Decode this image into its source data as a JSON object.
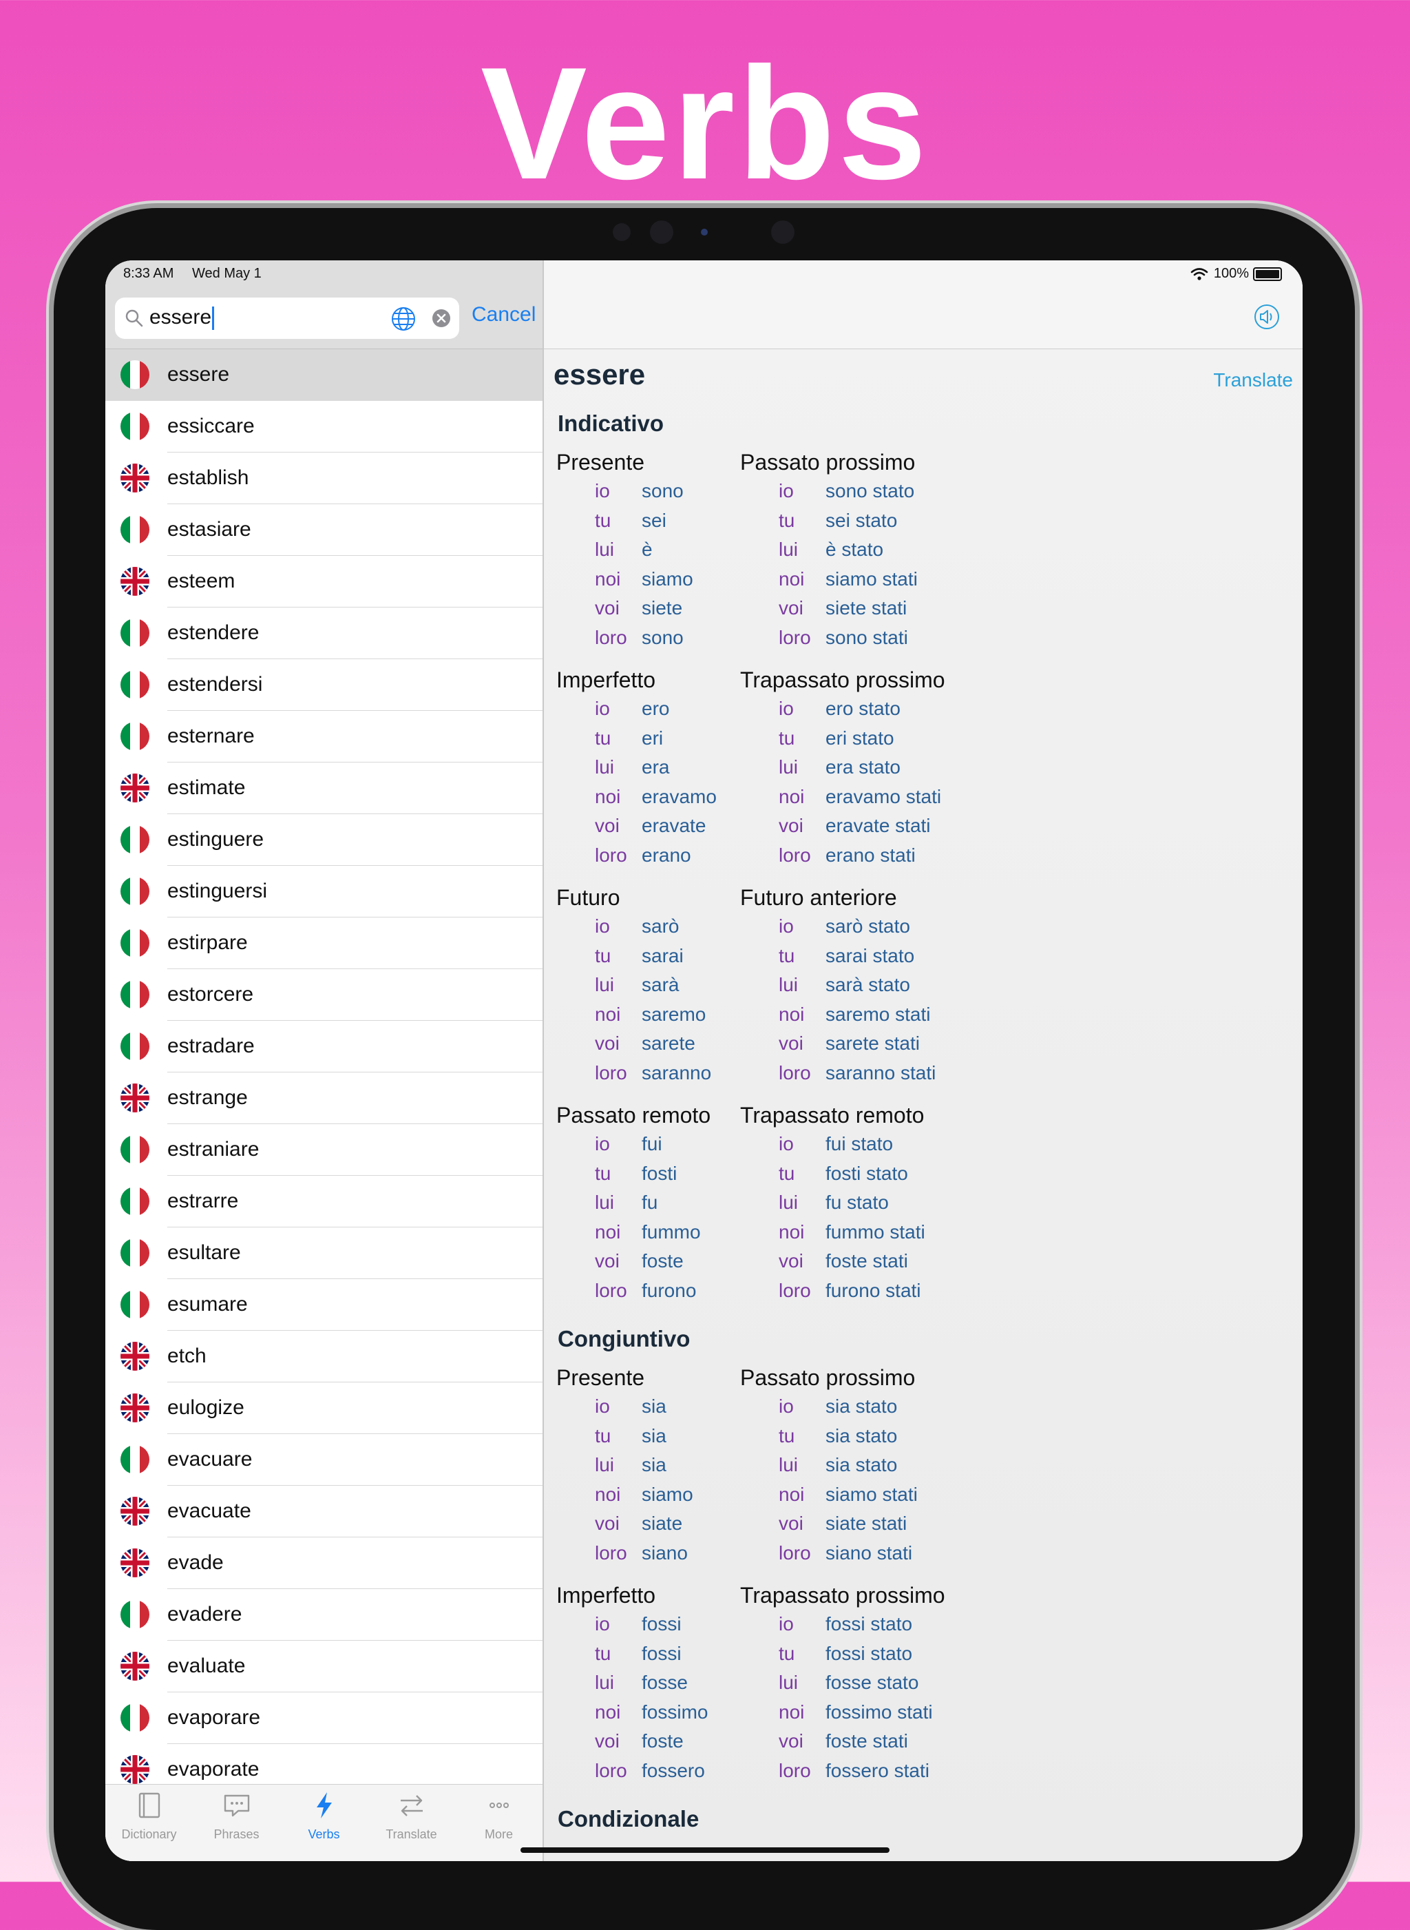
{
  "hero": {
    "title": "Verbs"
  },
  "status": {
    "time": "8:33 AM",
    "date": "Wed May 1",
    "battery": "100%"
  },
  "search": {
    "value": "essere",
    "cancel_label": "Cancel"
  },
  "words": [
    {
      "word": "essere",
      "lang": "it"
    },
    {
      "word": "essiccare",
      "lang": "it"
    },
    {
      "word": "establish",
      "lang": "en"
    },
    {
      "word": "estasiare",
      "lang": "it"
    },
    {
      "word": "esteem",
      "lang": "en"
    },
    {
      "word": "estendere",
      "lang": "it"
    },
    {
      "word": "estendersi",
      "lang": "it"
    },
    {
      "word": "esternare",
      "lang": "it"
    },
    {
      "word": "estimate",
      "lang": "en"
    },
    {
      "word": "estinguere",
      "lang": "it"
    },
    {
      "word": "estinguersi",
      "lang": "it"
    },
    {
      "word": "estirpare",
      "lang": "it"
    },
    {
      "word": "estorcere",
      "lang": "it"
    },
    {
      "word": "estradare",
      "lang": "it"
    },
    {
      "word": "estrange",
      "lang": "en"
    },
    {
      "word": "estraniare",
      "lang": "it"
    },
    {
      "word": "estrarre",
      "lang": "it"
    },
    {
      "word": "esultare",
      "lang": "it"
    },
    {
      "word": "esumare",
      "lang": "it"
    },
    {
      "word": "etch",
      "lang": "en"
    },
    {
      "word": "eulogize",
      "lang": "en"
    },
    {
      "word": "evacuare",
      "lang": "it"
    },
    {
      "word": "evacuate",
      "lang": "en"
    },
    {
      "word": "evade",
      "lang": "en"
    },
    {
      "word": "evadere",
      "lang": "it"
    },
    {
      "word": "evaluate",
      "lang": "en"
    },
    {
      "word": "evaporare",
      "lang": "it"
    },
    {
      "word": "evaporate",
      "lang": "en"
    }
  ],
  "tabs": [
    {
      "label": "Dictionary",
      "icon": "book-icon",
      "active": false
    },
    {
      "label": "Phrases",
      "icon": "speech-bubble-icon",
      "active": false
    },
    {
      "label": "Verbs",
      "icon": "lightning-icon",
      "active": true
    },
    {
      "label": "Translate",
      "icon": "swap-arrows-icon",
      "active": false
    },
    {
      "label": "More",
      "icon": "more-dots-icon",
      "active": false
    }
  ],
  "detail": {
    "verb": "essere",
    "translate_label": "Translate",
    "pronouns": [
      "io",
      "tu",
      "lui",
      "noi",
      "voi",
      "loro"
    ],
    "moods": [
      {
        "name": "Indicativo",
        "rows": [
          [
            {
              "name": "Presente",
              "forms": [
                "sono",
                "sei",
                "è",
                "siamo",
                "siete",
                "sono"
              ]
            },
            {
              "name": "Passato prossimo",
              "forms": [
                "sono stato",
                "sei stato",
                "è stato",
                "siamo stati",
                "siete stati",
                "sono stati"
              ]
            }
          ],
          [
            {
              "name": "Imperfetto",
              "forms": [
                "ero",
                "eri",
                "era",
                "eravamo",
                "eravate",
                "erano"
              ]
            },
            {
              "name": "Trapassato prossimo",
              "forms": [
                "ero stato",
                "eri stato",
                "era stato",
                "eravamo stati",
                "eravate stati",
                "erano stati"
              ]
            }
          ],
          [
            {
              "name": "Futuro",
              "forms": [
                "sarò",
                "sarai",
                "sarà",
                "saremo",
                "sarete",
                "saranno"
              ]
            },
            {
              "name": "Futuro anteriore",
              "forms": [
                "sarò stato",
                "sarai stato",
                "sarà stato",
                "saremo stati",
                "sarete stati",
                "saranno stati"
              ]
            }
          ],
          [
            {
              "name": "Passato remoto",
              "forms": [
                "fui",
                "fosti",
                "fu",
                "fummo",
                "foste",
                "furono"
              ]
            },
            {
              "name": "Trapassato remoto",
              "forms": [
                "fui stato",
                "fosti stato",
                "fu stato",
                "fummo stati",
                "foste stati",
                "furono stati"
              ]
            }
          ]
        ]
      },
      {
        "name": "Congiuntivo",
        "rows": [
          [
            {
              "name": "Presente",
              "forms": [
                "sia",
                "sia",
                "sia",
                "siamo",
                "siate",
                "siano"
              ]
            },
            {
              "name": "Passato prossimo",
              "forms": [
                "sia stato",
                "sia stato",
                "sia stato",
                "siamo stati",
                "siate stati",
                "siano stati"
              ]
            }
          ],
          [
            {
              "name": "Imperfetto",
              "forms": [
                "fossi",
                "fossi",
                "fosse",
                "fossimo",
                "foste",
                "fossero"
              ]
            },
            {
              "name": "Trapassato prossimo",
              "forms": [
                "fossi stato",
                "fossi stato",
                "fosse stato",
                "fossimo stati",
                "foste stati",
                "fossero stati"
              ]
            }
          ]
        ]
      },
      {
        "name": "Condizionale",
        "rows": []
      }
    ]
  },
  "colors": {
    "accent": "#1a7ff0",
    "pronoun": "#7a3aa0",
    "form": "#2a5f96",
    "link": "#2ba0d8"
  }
}
